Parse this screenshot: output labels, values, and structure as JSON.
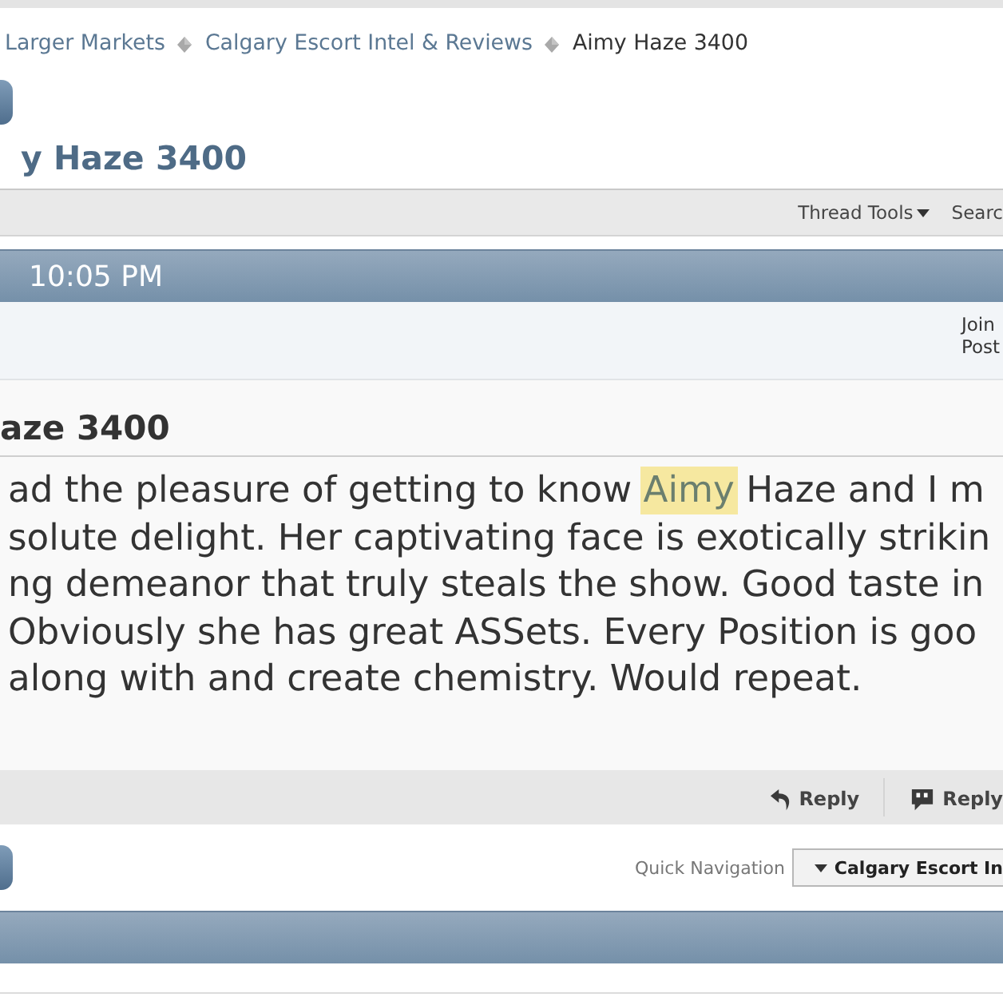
{
  "breadcrumb": [
    {
      "label": "Larger Markets",
      "current": false
    },
    {
      "label": "Calgary Escort Intel & Reviews",
      "current": false
    },
    {
      "label": "Aimy Haze 3400",
      "current": true
    }
  ],
  "thread_title": "y Haze 3400",
  "thread_toolbar": [
    {
      "label": "Thread Tools",
      "has_menu": true
    },
    {
      "label": "Searc",
      "has_menu": false
    }
  ],
  "post": {
    "date": "10:05 PM",
    "user_info": [
      "Join",
      "Post"
    ],
    "title": "aze 3400",
    "message_lines": [
      [
        {
          "text": "ad the pleasure of getting to know ",
          "highlighted": false
        },
        {
          "text": "Aimy",
          "highlighted": true
        },
        {
          "text": " Haze and I m",
          "highlighted": false
        }
      ],
      [
        {
          "text": "solute delight. Her captivating face is exotically strikin",
          "highlighted": false
        }
      ],
      [
        {
          "text": "ng demeanor that truly steals the show. Good taste in",
          "highlighted": false
        }
      ],
      [
        {
          "text": "Obviously she has great ASSets. Every Position is goo",
          "highlighted": false
        }
      ],
      [
        {
          "text": "along with and create chemistry. Would repeat.",
          "highlighted": false
        }
      ]
    ],
    "actions": [
      {
        "label": "Reply",
        "kind": "reply"
      },
      {
        "label": "Reply",
        "kind": "quote"
      }
    ]
  },
  "quick_navigation": {
    "label": "Quick Navigation",
    "value": "Calgary Escort In"
  }
}
